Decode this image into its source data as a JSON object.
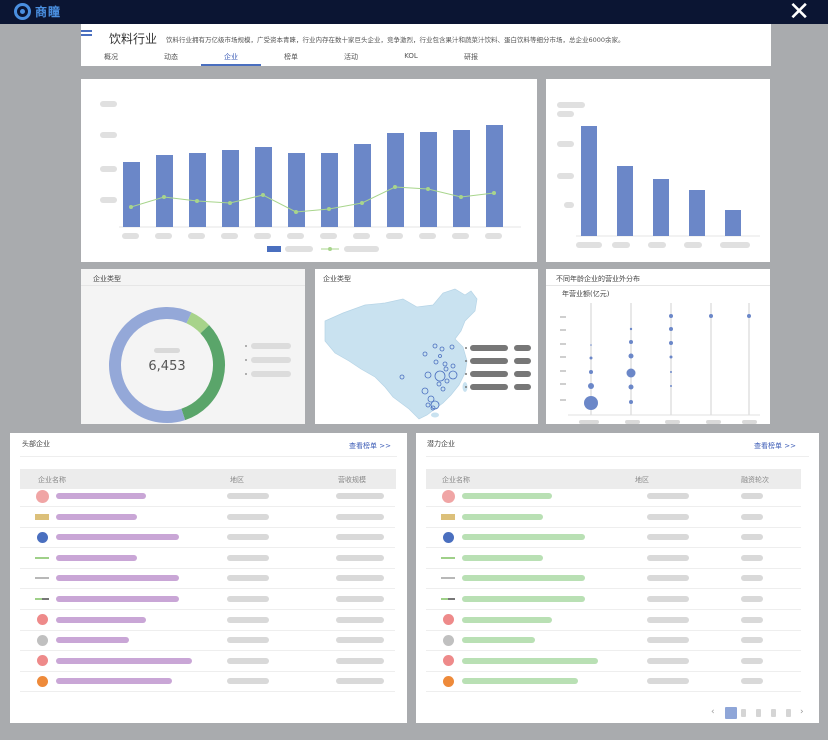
{
  "app": {
    "logo_text": "商瞳",
    "close_symbol": "✕"
  },
  "header": {
    "title": "饮料行业",
    "description": "饮料行业拥有万亿级市场规模，广受资本青睐，行业内存在数十家巨头企业，竞争激烈，行业包含果汁和蔬菜汁饮料、蛋白饮料等细分市场，总企业6000余家。",
    "tabs": [
      "概况",
      "动态",
      "企业",
      "榜单",
      "活动",
      "KOL",
      "研报"
    ],
    "active_tab": "企业"
  },
  "colors": {
    "bar": "#6b87c8",
    "line": "#a8d58c",
    "donut_blue": "#94a8d8",
    "donut_green": "#5aa56a",
    "donut_lightgreen": "#a7d38a",
    "map": "#c9e2f0",
    "bubble": "#6b87c8"
  },
  "chart_data": [
    {
      "type": "bar",
      "values": [
        65,
        72,
        74,
        77,
        80,
        74,
        74,
        83,
        94,
        95,
        97,
        102
      ],
      "line": [
        10,
        20,
        16,
        14,
        22,
        5,
        8,
        14,
        30,
        28,
        20,
        24
      ]
    },
    {
      "type": "bar",
      "values": [
        110,
        70,
        57,
        46,
        26
      ]
    },
    {
      "type": "pie",
      "center_value": "6,453",
      "slices": [
        62,
        32,
        6
      ]
    },
    {
      "type": "scatter",
      "title": "不同年龄企业的营业外分布",
      "ylabel": "年营业额(亿元)"
    }
  ],
  "panels": {
    "donut_title": "企业类型",
    "map_title": "企业类型",
    "scatter_title": "不同年龄企业的营业外分布",
    "scatter_ylabel": "年营业额(亿元)"
  },
  "left_table": {
    "title": "头部企业",
    "link": "查看榜单 >>",
    "columns": [
      "企业名称",
      "地区",
      "营收规模"
    ],
    "markers": [
      "#f0a5a5",
      "#dcc07a",
      "#4a6fbf",
      "#9fd089",
      "#b8b8b8",
      "#9fd089|#777777",
      "#ee8a8a",
      "#c0c0c0",
      "#ee8a8a",
      "#ee8a3a"
    ],
    "marker_shapes": [
      "circle",
      "rect",
      "circle",
      "line",
      "line",
      "dual",
      "circle",
      "circle",
      "circle",
      "circle"
    ]
  },
  "right_table": {
    "title": "潜力企业",
    "link": "查看榜单 >>",
    "columns": [
      "企业名称",
      "地区",
      "融资轮次"
    ],
    "markers": [
      "#f0a5a5",
      "#dcc07a",
      "#4a6fbf",
      "#9fd089",
      "#b8b8b8",
      "#9fd089|#777777",
      "#ee8a8a",
      "#c0c0c0",
      "#ee8a8a",
      "#ee8a3a"
    ],
    "marker_shapes": [
      "circle",
      "rect",
      "circle",
      "line",
      "line",
      "dual",
      "circle",
      "circle",
      "circle",
      "circle"
    ]
  },
  "pager": {
    "prev": "‹",
    "next": "›"
  }
}
